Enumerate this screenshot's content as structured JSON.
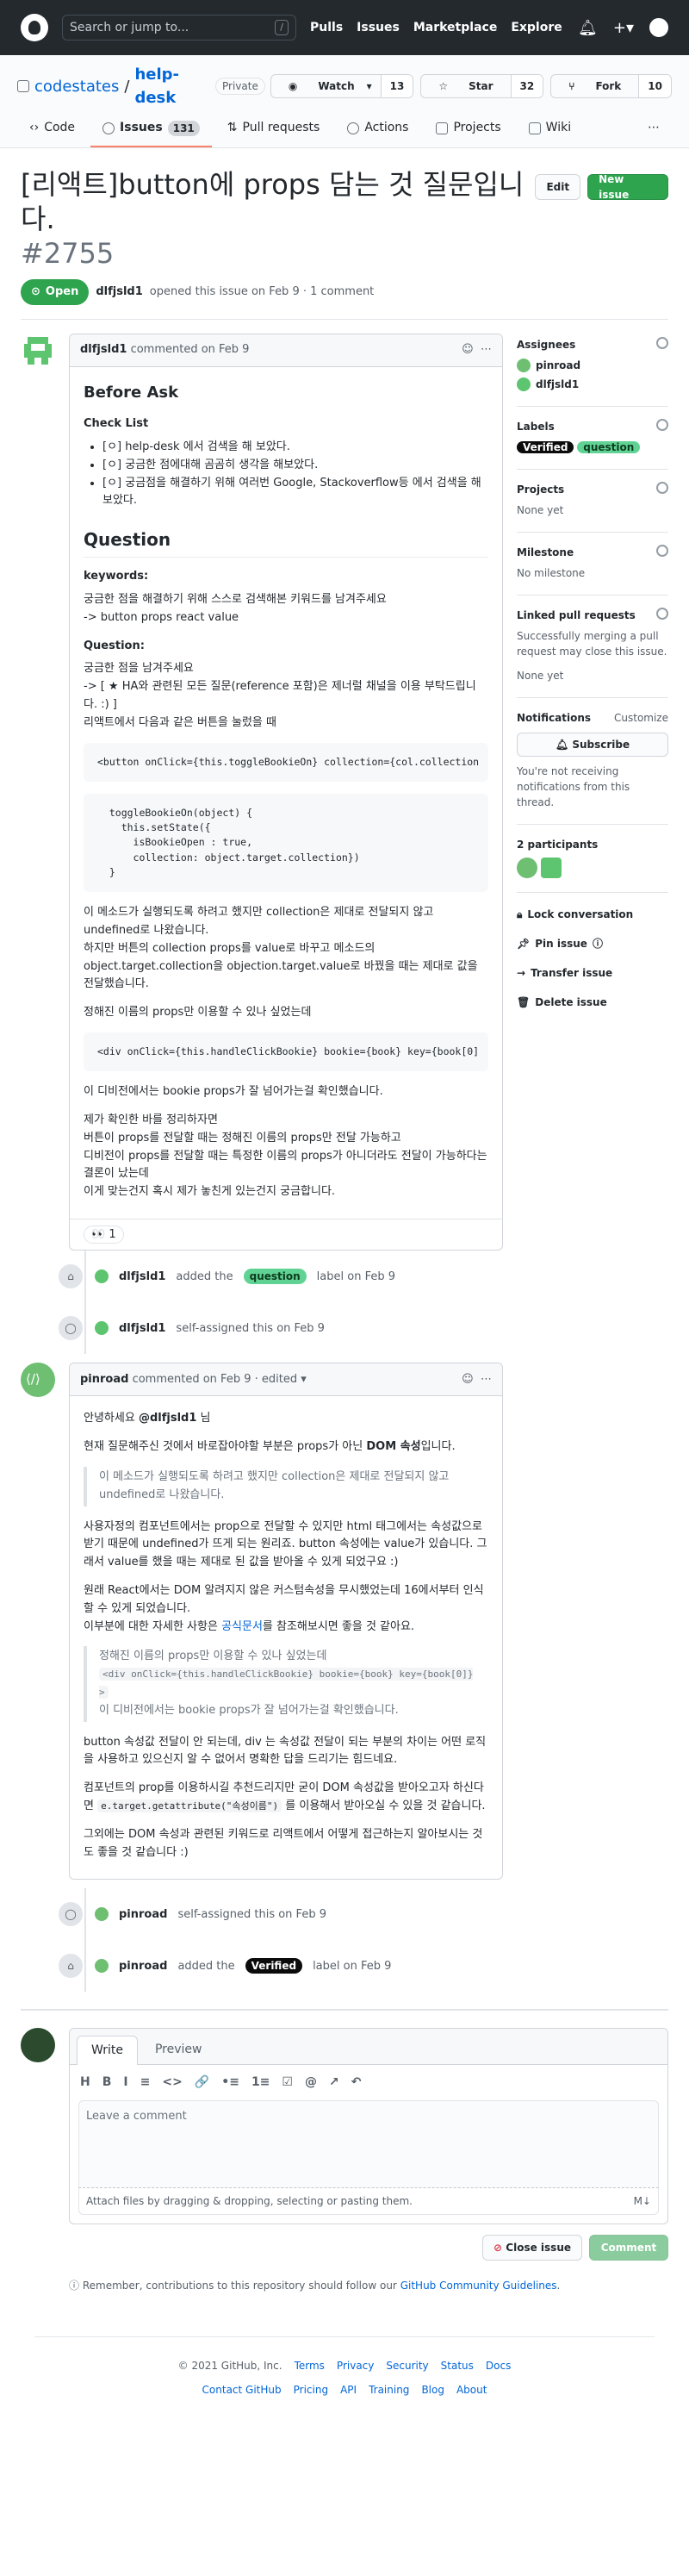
{
  "header": {
    "search_placeholder": "Search or jump to...",
    "search_key": "/",
    "nav": [
      "Pulls",
      "Issues",
      "Marketplace",
      "Explore"
    ]
  },
  "repo": {
    "owner": "codestates",
    "separator": "/",
    "name": "help-desk",
    "visibility": "Private",
    "watch_label": "Watch",
    "watch_count": "13",
    "star_label": "Star",
    "star_count": "32",
    "fork_label": "Fork",
    "fork_count": "10",
    "tabs": [
      {
        "label": "Code"
      },
      {
        "label": "Issues",
        "count": "131"
      },
      {
        "label": "Pull requests"
      },
      {
        "label": "Actions"
      },
      {
        "label": "Projects"
      },
      {
        "label": "Wiki"
      }
    ]
  },
  "issue": {
    "title": "[리액트]button에 props 담는 것 질문입니다.",
    "number": "#2755",
    "edit_label": "Edit",
    "new_issue_label": "New issue",
    "status": "Open",
    "author": "dlfjsld1",
    "meta_text": "opened this issue on Feb 9 · 1 comment"
  },
  "comment1": {
    "author": "dlfjsld1",
    "action": "commented on Feb 9",
    "h_before": "Before Ask",
    "h_checklist": "Check List",
    "checklist": [
      "[ㅇ] help-desk 에서 검색을 해 보았다.",
      "[ㅇ] 궁금한 점에대해 곰곰히 생각을 해보았다.",
      "[ㅇ] 궁금점을 해결하기 위해 여러번 Google, Stackoverflow등 에서 검색을 해보았다."
    ],
    "h_question": "Question",
    "h_keywords": "keywords:",
    "kw_line1": "궁금한 점을 해결하기 위해 스스로 검색해본 키워드를 남겨주세요",
    "kw_line2": "-> button props react value",
    "h_q2": "Question:",
    "q_line1": "궁금한 점을 남겨주세요",
    "q_line2": "-> [ ★ HA와 관련된 모든 질문(reference 포함)은 제너럴 채널을 이용 부탁드립니다. :) ]",
    "q_line3": "리액트에서 다음과 같은 버튼을 눌렀을 때",
    "code1": "<button onClick={this.toggleBookieOn} collection={col.collection",
    "code2": "  toggleBookieOn(object) {\n    this.setState({\n      isBookieOpen : true,\n      collection: object.target.collection})\n  }",
    "p1": "이 메소드가 실행되도록 하려고 했지만 collection은 제대로 전달되지 않고 undefined로 나왔습니다.",
    "p2": "하지만 버튼의 collection props를 value로 바꾸고 메소드의 object.target.collection을 objection.target.value로 바꿨을 때는 제대로 값을 전달했습니다.",
    "p3": "정해진 이름의 props만 이용할 수 있나 싶었는데",
    "code3": "<div onClick={this.handleClickBookie} bookie={book} key={book[0]",
    "p4": "이 디비전에서는 bookie props가 잘 넘어가는걸 확인했습니다.",
    "p5": "제가 확인한 바를 정리하자면",
    "p6": "버튼이 props를 전달할 때는 정해진 이름의 props만 전달 가능하고",
    "p7": "디비전이 props를 전달할 때는 특정한 이름의 props가 아니더라도 전달이 가능하다는 결론이 났는데",
    "p8": "이게 맞는건지 혹시 제가 놓친게 있는건지 궁금합니다.",
    "reaction": "👀 1"
  },
  "events": {
    "e1_user": "dlfjsld1",
    "e1_pre": "added the",
    "e1_label": "question",
    "e1_post": "label on Feb 9",
    "e2_user": "dlfjsld1",
    "e2_text": "self-assigned this on Feb 9",
    "e3_user": "pinroad",
    "e3_text": "self-assigned this on Feb 9",
    "e4_user": "pinroad",
    "e4_pre": "added the",
    "e4_label": "Verified",
    "e4_post": "label on Feb 9"
  },
  "comment2": {
    "author": "pinroad",
    "action": "commented on Feb 9 · edited ▾",
    "greet_pre": "안녕하세요",
    "greet_user": "@dlfjsld1",
    "greet_post": "님",
    "p1_pre": "현재 질문해주신 것에서 바로잡아야할 부분은 props가 아닌",
    "p1_bold": "DOM 속성",
    "p1_post": "입니다.",
    "quote1": "이 메소드가 실행되도록 하려고 했지만 collection은 제대로 전달되지 않고 undefined로 나왔습니다.",
    "p2": "사용자정의 컴포넌트에서는 prop으로 전달할 수 있지만 html 태그에서는 속성값으로 받기 때문에 undefined가 뜨게 되는 원리죠. button 속성에는 value가 있습니다. 그래서 value를 했을 때는 제대로 된 값을 받아올 수 있게 되었구요 :)",
    "p3": "원래 React에서는 DOM 알려지지 않은 커스텀속성을 무시했었는데 16에서부터 인식할 수 있게 되었습니다.",
    "p4_pre": "이부분에 대한 자세한 사항은",
    "p4_link": "공식문서",
    "p4_post": "를 참조해보시면 좋을 것 같아요.",
    "quote2a": "정해진 이름의 props만 이용할 수 있나 싶었는데",
    "quote2b": "<div onClick={this.handleClickBookie} bookie={book} key={book[0]} >",
    "quote2c": "이 디비전에서는 bookie props가 잘 넘어가는걸 확인했습니다.",
    "p5": "button 속성값 전달이 안 되는데, div 는 속성값 전달이 되는 부분의 차이는 어떤 로직을 사용하고 있으신지 알 수 없어서 명확한 답을 드리기는 힘드네요.",
    "p6_pre": "컴포넌트의 prop를 이용하시길 추천드리지만 굳이 DOM 속성값을 받아오고자 하신다면",
    "p6_code": "e.target.getattribute(\"속성이름\")",
    "p6_post": "를 이용해서 받아오실 수 있을 것 같습니다.",
    "p7": "그외에는 DOM 속성과 관련된 키워드로 리액트에서 어떻게 접근하는지 알아보시는 것도 좋을 것 같습니다 :)"
  },
  "sidebar": {
    "assignees_h": "Assignees",
    "assignees": [
      "pinroad",
      "dlfjsld1"
    ],
    "labels_h": "Labels",
    "labels": [
      "Verified",
      "question"
    ],
    "projects_h": "Projects",
    "projects_v": "None yet",
    "milestone_h": "Milestone",
    "milestone_v": "No milestone",
    "linked_h": "Linked pull requests",
    "linked_desc": "Successfully merging a pull request may close this issue.",
    "linked_v": "None yet",
    "notif_h": "Notifications",
    "notif_customize": "Customize",
    "subscribe": "Subscribe",
    "notif_desc": "You're not receiving notifications from this thread.",
    "participants_h": "2 participants",
    "lock": "Lock conversation",
    "pin": "Pin issue",
    "transfer": "Transfer issue",
    "delete": "Delete issue"
  },
  "editor": {
    "tab_write": "Write",
    "tab_preview": "Preview",
    "tools": [
      "H",
      "B",
      "I",
      "≡",
      "<>",
      "🔗",
      "•≡",
      "1≡",
      "☑",
      "@",
      "↗",
      "↶"
    ],
    "placeholder": "Leave a comment",
    "attach": "Attach files by dragging & dropping, selecting or pasting them.",
    "md": "M↓",
    "close_label": "Close issue",
    "comment_label": "Comment"
  },
  "notice": {
    "text": "Remember, contributions to this repository should follow our",
    "link": "GitHub Community Guidelines",
    "end": "."
  },
  "footer": {
    "copyright": "© 2021 GitHub, Inc.",
    "row1": [
      "Terms",
      "Privacy",
      "Security",
      "Status",
      "Docs"
    ],
    "row2": [
      "Contact GitHub",
      "Pricing",
      "API",
      "Training",
      "Blog",
      "About"
    ]
  }
}
